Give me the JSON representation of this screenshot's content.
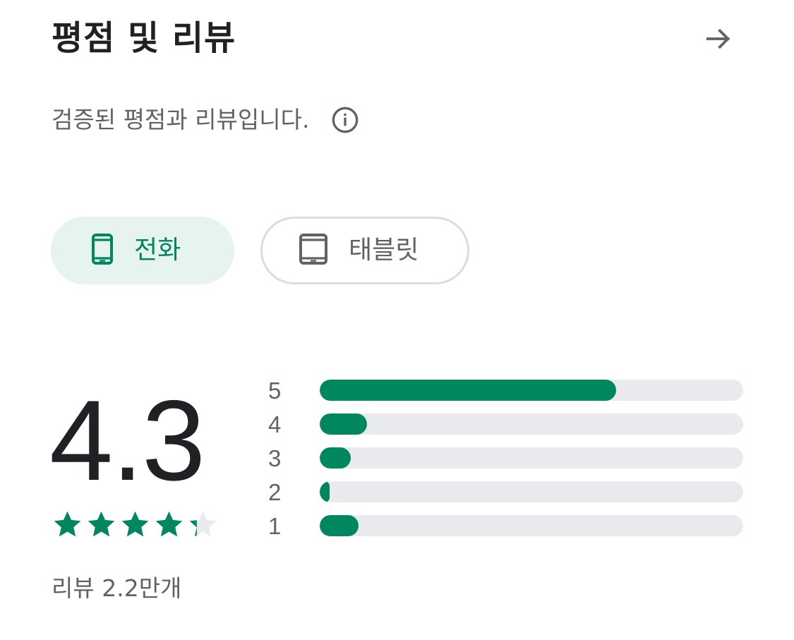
{
  "header": {
    "title": "평점 및 리뷰",
    "arrow_icon": "arrow-right-icon"
  },
  "subtitle": {
    "text": "검증된 평점과 리뷰입니다.",
    "info_icon": "info-icon"
  },
  "device_tabs": [
    {
      "label": "전화",
      "icon": "phone-icon",
      "selected": true
    },
    {
      "label": "태블릿",
      "icon": "tablet-icon",
      "selected": false
    }
  ],
  "rating": {
    "value": "4.3",
    "stars": 4.3,
    "review_count": "리뷰 2.2만개"
  },
  "histogram": [
    {
      "label": "5",
      "fraction": 0.7
    },
    {
      "label": "4",
      "fraction": 0.112
    },
    {
      "label": "3",
      "fraction": 0.073
    },
    {
      "label": "2",
      "fraction": 0.023
    },
    {
      "label": "1",
      "fraction": 0.092
    }
  ],
  "colors": {
    "accent": "#01875f",
    "selected_chip_bg": "#e6f3ef",
    "bar_track": "#e8eaed",
    "text_primary": "#202124",
    "text_secondary": "#5f6368",
    "star_empty": "#e8eaed"
  }
}
